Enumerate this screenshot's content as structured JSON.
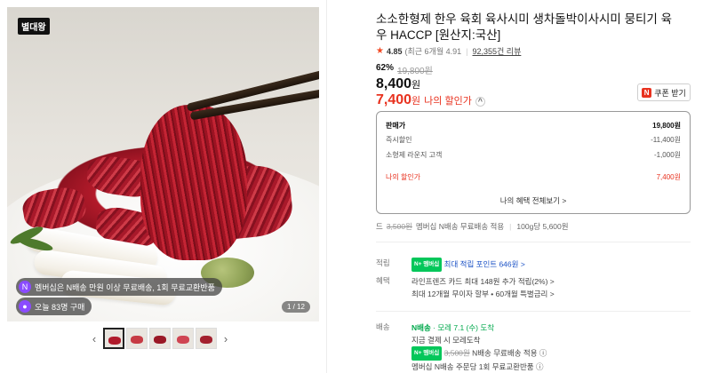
{
  "gallery": {
    "brand_tag": "별대왕",
    "chip_membership": "멤버십은 N배송 만원 이상 무료배송, 1회 무료교환반품",
    "chip_today": "오늘 83명 구매",
    "page_counter": "1 / 12",
    "thumbnail_count": 5,
    "prev_icon": "chevron-left-icon",
    "next_icon": "chevron-right-icon"
  },
  "product": {
    "title": "소소한형제 한우 육회 육사시미 생차돌박이사시미 뭉티기 육우 HACCP [원산지:국산]",
    "rating": "4.85",
    "rating_sub": "(최근 6개월 4.91",
    "reviews": "92,355건 리뷰",
    "discount_pct": "62%",
    "original_price": "19,800원",
    "price": "8,400",
    "price_unit": "원",
    "my_price": "7,400",
    "my_price_unit": "원",
    "my_price_label": "나의 할인가",
    "coupon_button": "쿠폰 받기"
  },
  "price_box": {
    "rows": [
      {
        "label": "판매가",
        "value": "19,800원"
      },
      {
        "label": "즉시할인",
        "value": "-11,400원"
      },
      {
        "label": "소형제 라운지 고객",
        "value": "-1,000원"
      },
      {
        "label": "나의 할인가",
        "value": "7,400원"
      }
    ],
    "more_link": "나의 혜택 전체보기 >"
  },
  "unit": {
    "prefix": "드",
    "strike_fee": "3,500원",
    "text": "멤버십 N배송 무료배송 적용",
    "unit_price": "100g당 5,600원"
  },
  "benefits": {
    "points_label": "적립",
    "points_badge": "N+ 멤버십",
    "points_text": "최대 적립 포인트 646원 >",
    "perks_label": "혜택",
    "perks_line1": "라인프렌즈 카드 최대 148원 추가 적립(2%) >",
    "perks_line2": "최대 12개월 무이자 할부 • 60개월 특별금리 >"
  },
  "delivery": {
    "label": "배송",
    "badge": "N배송",
    "date_text": "· 모레 7.1 (수) 도착",
    "line2": "지금 결제 시 모레도착",
    "line3_badge": "N+ 멤버십",
    "line3_strike": "3,500원",
    "line3_text": "N배송 무료배송 적용 ⓘ",
    "line4": "멤버십 N배송 주문당 1회 무료교환반품 ⓘ"
  }
}
